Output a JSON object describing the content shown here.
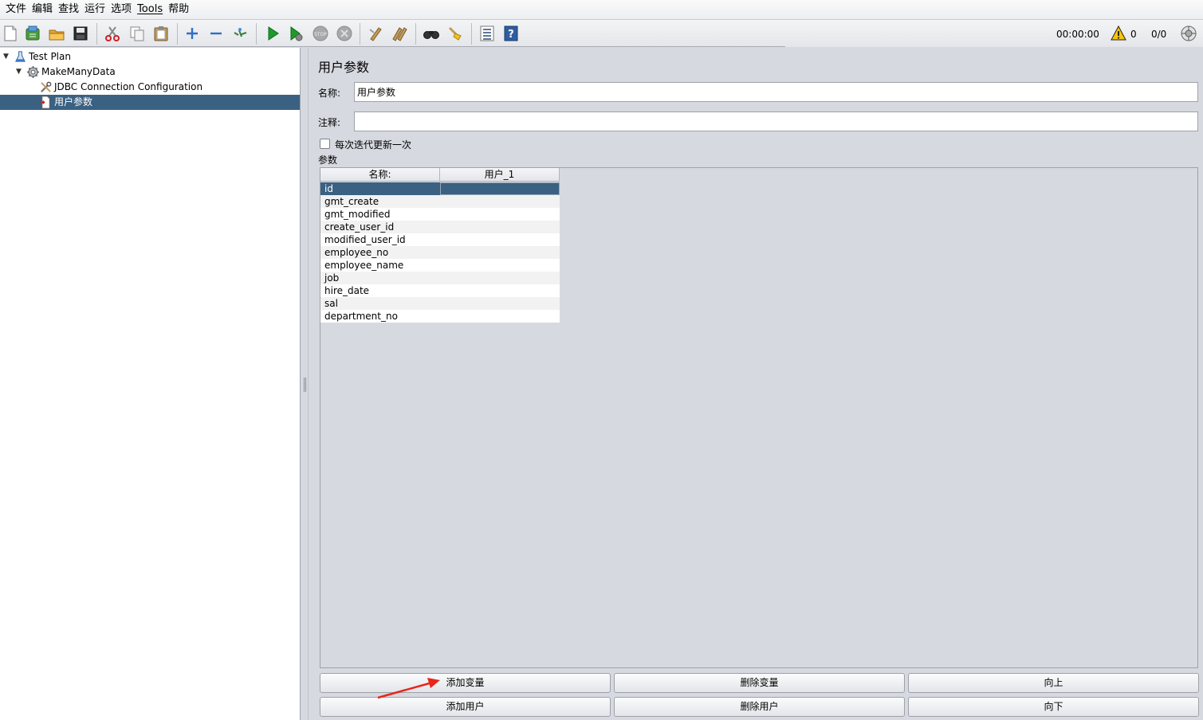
{
  "menu": [
    "文件",
    "编辑",
    "查找",
    "运行",
    "选项",
    "Tools",
    "帮助"
  ],
  "status": {
    "time": "00:00:00",
    "warnings": "0",
    "threads": "0/0"
  },
  "toolbar_icons": [
    "new-icon",
    "templates-icon",
    "open-icon",
    "save-icon",
    "cut-icon",
    "copy-icon",
    "paste-icon",
    "expand-icon",
    "collapse-icon",
    "toggle-icon",
    "start-icon",
    "start-no-pause-icon",
    "stop-icon",
    "shutdown-icon",
    "clear-icon",
    "clear-all-icon",
    "search-icon",
    "reset-search-icon",
    "function-helper-icon",
    "help-icon"
  ],
  "tree": {
    "items": [
      {
        "label": "Test Plan",
        "icon": "flask-icon",
        "selected": false
      },
      {
        "label": "MakeManyData",
        "icon": "gear-icon",
        "selected": false
      },
      {
        "label": "JDBC Connection Configuration",
        "icon": "wrench-icon",
        "selected": false
      },
      {
        "label": "用户参数",
        "icon": "document-icon",
        "selected": true
      }
    ]
  },
  "panel": {
    "title": "用户参数",
    "name_label": "名称:",
    "name_value": "用户参数",
    "comment_label": "注释:",
    "comment_value": "",
    "checkbox_label": "每次迭代更新一次",
    "checkbox_checked": false,
    "params_label": "参数"
  },
  "table": {
    "headers": [
      "名称:",
      "用户_1"
    ],
    "rows": [
      [
        "id",
        ""
      ],
      [
        "gmt_create",
        ""
      ],
      [
        "gmt_modified",
        ""
      ],
      [
        "create_user_id",
        ""
      ],
      [
        "modified_user_id",
        ""
      ],
      [
        "employee_no",
        ""
      ],
      [
        "employee_name",
        ""
      ],
      [
        "job",
        ""
      ],
      [
        "hire_date",
        ""
      ],
      [
        "sal",
        ""
      ],
      [
        "department_no",
        ""
      ]
    ],
    "selected_row": 0
  },
  "buttons": {
    "add_variable": "添加变量",
    "delete_variable": "删除变量",
    "move_up": "向上",
    "add_user": "添加用户",
    "delete_user": "删除用户",
    "move_down": "向下"
  },
  "colors": {
    "selection": "#3a6182",
    "annotation_arrow": "#e8261c"
  }
}
